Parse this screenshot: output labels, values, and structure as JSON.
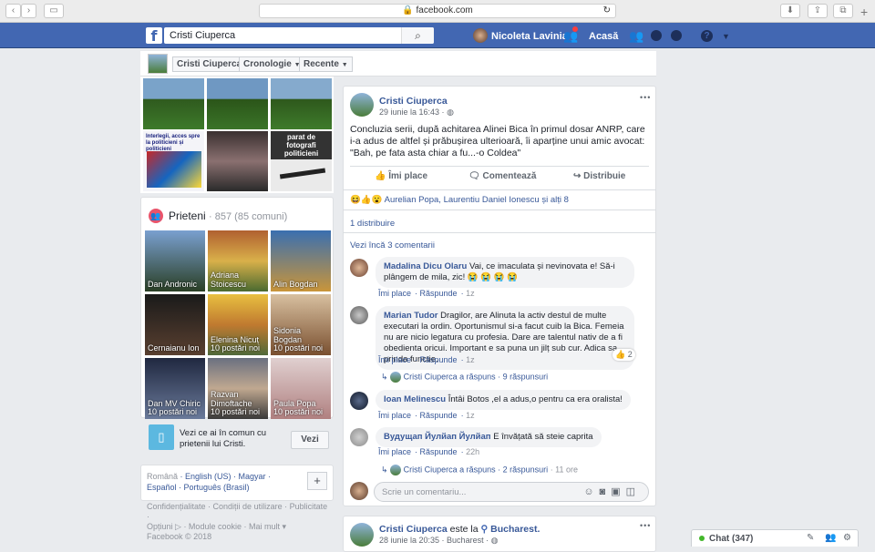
{
  "browser": {
    "url": "facebook.com"
  },
  "topbar": {
    "search_value": "Cristi Ciuperca",
    "user_name": "Nicoleta Lavinia",
    "home": "Acasă"
  },
  "profile_nav": {
    "name": "Cristi Ciuperca",
    "timeline": "Cronologie",
    "recent": "Recente"
  },
  "photos": {
    "caption_1": "Interlegii, acces spre la politicieni și politicieni",
    "caption_2": "parat de fotografi politicieni"
  },
  "friends": {
    "title": "Prieteni",
    "count": "· 857 (85 comuni)",
    "items": [
      {
        "name": "Dan Andronic",
        "sub": ""
      },
      {
        "name": "Adriana Stoicescu",
        "sub": ""
      },
      {
        "name": "Alin Bogdan",
        "sub": ""
      },
      {
        "name": "Cernaianu Ion",
        "sub": ""
      },
      {
        "name": "Elenina Nicuț",
        "sub": "10 postări noi"
      },
      {
        "name": "Sidonia Bogdan",
        "sub": "10 postări noi"
      },
      {
        "name": "Dan MV Chiric",
        "sub": "10 postări noi"
      },
      {
        "name": "Razvan Dimoftache",
        "sub": "10 postări noi"
      },
      {
        "name": "Paula Popa",
        "sub": "10 postări noi"
      }
    ],
    "common_text": "Vezi ce ai în comun cu prietenii lui Cristi.",
    "common_button": "Vezi"
  },
  "languages": {
    "l1": "Română",
    "l2": "English (US)",
    "l3": "Magyar",
    "l4": "Español",
    "l5": "Português (Brasil)",
    "add": "+"
  },
  "footer": {
    "line1": "Confidențialitate · Condiții de utilizare · Publicitate ·",
    "line2": "Opțiuni ▷ · Module cookie · Mai mult ▾",
    "line3": "Facebook © 2018"
  },
  "post1": {
    "author": "Cristi Ciuperca",
    "time": "29 iunie la 16:43 ·",
    "more": "•••",
    "text": "Concluzia serii, după achitarea Alinei Bica în primul dosar ANRP, care i-a adus de altfel și prăbușirea ulterioară, îi aparține unui amic avocat: \"Bah, pe fata asta chiar a fu...-o Coldea\"",
    "like": "Îmi place",
    "comment": "Comentează",
    "share": "Distribuie",
    "reactions": "Aurelian Popa, Laurentiu Daniel Ionescu și alți 8",
    "shares": "1 distribuire",
    "more_comments": "Vezi încă 3 comentarii",
    "comments": [
      {
        "author": "Madalina Dicu Olaru",
        "text": "Vai, ce imaculata și nevinovata e! Să-i plângem de mila, zic! 😭 😭 😭 😭",
        "like": "Îmi place",
        "reply": "Răspunde",
        "time": "1z"
      },
      {
        "author": "Marian Tudor",
        "text": "Dragilor, are Alinuta la activ destul de multe executari la ordin. Oportunismul si-a facut cuib la Bica. Femeia nu are nicio legatura cu profesia. Dare are talentul nativ de a fi obedienta oricui. Important e sa puna un jilț sub cur. Adica sa prinda functie.",
        "like": "Îmi place",
        "reply": "Răspunde",
        "time": "1z",
        "reactions": "2",
        "reply_author": "Cristi Ciuperca a răspuns",
        "reply_count": "· 9 răspunsuri"
      },
      {
        "author": "Ioan Melinescu",
        "text": "Întâi Botos ,el a adus,o pentru ca era oralista!",
        "like": "Îmi place",
        "reply": "Răspunde",
        "time": "1z"
      },
      {
        "author": "Вудущап Йулйап Йулйап",
        "text": "E învățată să steie caprita",
        "like": "Îmi place",
        "reply": "Răspunde",
        "time": "22h",
        "reply_author": "Cristi Ciuperca a răspuns",
        "reply_count": "· 2 răspunsuri",
        "reply_time": "· 11 ore"
      }
    ],
    "write_placeholder": "Scrie un comentariu..."
  },
  "post2": {
    "author": "Cristi Ciuperca",
    "verb": "este la",
    "place": "Bucharest.",
    "time": "28 iunie la 20:35 · Bucharest ·",
    "more": "•••"
  },
  "chat": {
    "label": "Chat (347)"
  }
}
